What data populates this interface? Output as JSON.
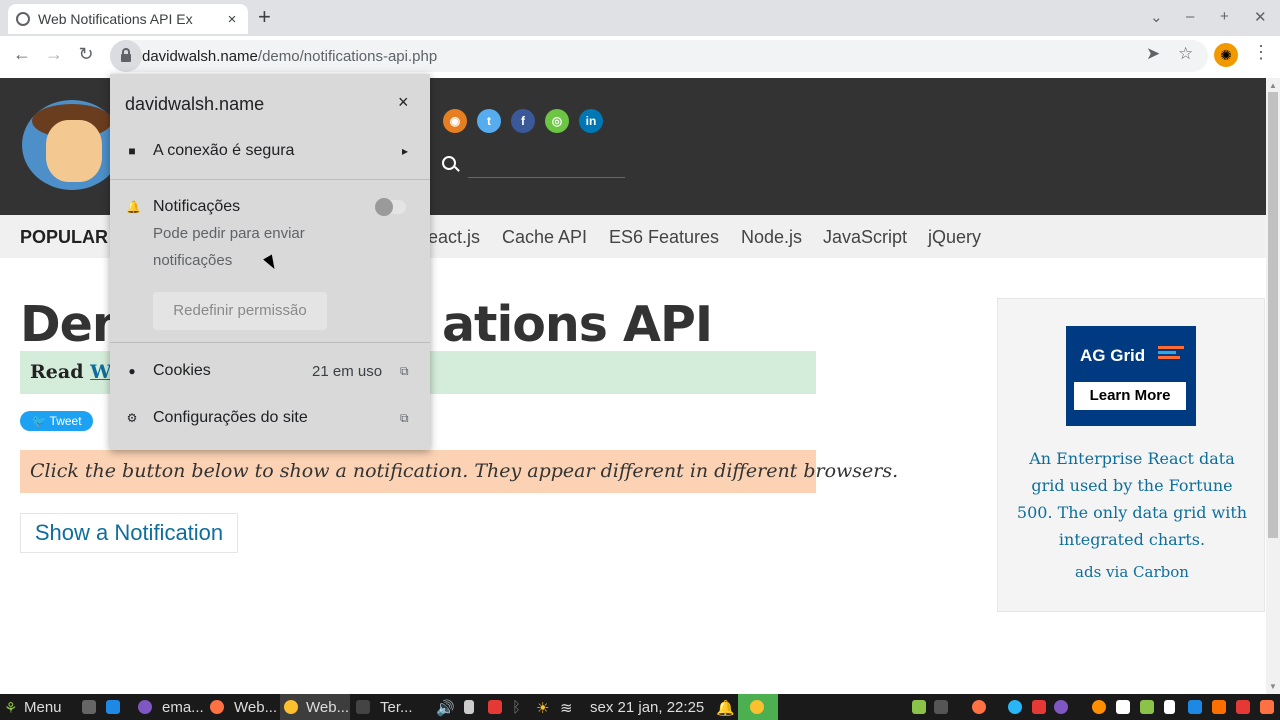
{
  "browser": {
    "tab_title": "Web Notifications API Ex",
    "tab_close": "×",
    "new_tab": "+",
    "window_controls": [
      "⌄",
      "–",
      "+",
      "✕"
    ],
    "url_host": "davidwalsh.name",
    "url_path": "/demo/notifications-api.php",
    "nav_back": "←",
    "nav_forward": "→",
    "nav_reload": "↻",
    "send_icon": "➤",
    "star_icon": "☆",
    "menu_icon": "⋮",
    "profile_icon": "✺"
  },
  "site": {
    "social_icons": [
      {
        "name": "rss-icon",
        "glyph": "◉",
        "color": "#e67e22"
      },
      {
        "name": "twitter-icon",
        "glyph": "t",
        "color": "#55acee"
      },
      {
        "name": "facebook-icon",
        "glyph": "f",
        "color": "#3b5998"
      },
      {
        "name": "github-icon",
        "glyph": "◎",
        "color": "#6cc644"
      },
      {
        "name": "linkedin-icon",
        "glyph": "in",
        "color": "#0077b5"
      }
    ],
    "nav": {
      "popular": "POPULAR",
      "items": [
        "eact.js",
        "Cache API",
        "ES6 Features",
        "Node.js",
        "JavaScript",
        "jQuery"
      ]
    },
    "title_left": "Dem",
    "title_right": "ations API",
    "read_prefix": "Read",
    "read_link": "We",
    "tweet": "Tweet",
    "instruction": "Click the button below to show a notification. They appear different in different browsers.",
    "show_button": "Show a Notification"
  },
  "ad": {
    "brand": "AG Grid",
    "cta": "Learn More",
    "text": "An Enterprise React data grid used by the Fortune 500. The only data grid with integrated charts.",
    "via": "ads via Carbon"
  },
  "popup": {
    "host": "davidwalsh.name",
    "close": "×",
    "connection": "A conexão é segura",
    "connection_arrow": "▸",
    "notifications_label": "Notificações",
    "notifications_sub1": "Pode pedir para enviar",
    "notifications_sub2": "notificações",
    "reset_button": "Redefinir permissão",
    "cookies_label": "Cookies",
    "cookies_count": "21 em uso",
    "site_settings": "Configurações do site",
    "ext_icon": "⧉"
  },
  "taskbar": {
    "menu": "Menu",
    "items": [
      "ema...",
      "Web...",
      "Web...",
      "Ter..."
    ],
    "datetime": "sex 21 jan, 22:25"
  },
  "colors": {
    "page_header": "#333333",
    "link": "#0f6e9c",
    "read_bar": "#d4edda",
    "instruction_bar": "#fbd3b4",
    "ad_bg": "#003a80"
  }
}
